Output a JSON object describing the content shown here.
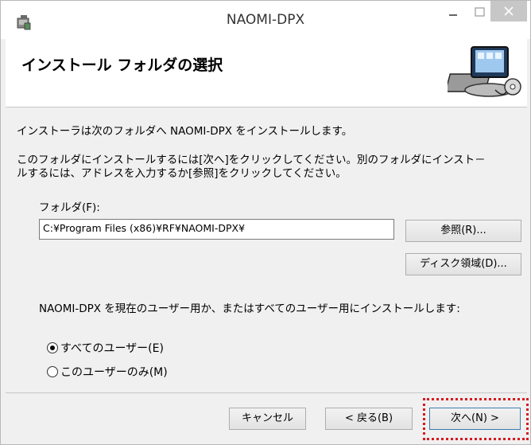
{
  "window": {
    "title": "NAOMI-DPX",
    "minimize_glyph": "–",
    "close_glyph": "✕"
  },
  "header": {
    "title": "インストール フォルダの選択",
    "art_icon": "computer-install-icon"
  },
  "content": {
    "intro": "インストーラは次のフォルダへ NAOMI-DPX をインストールします。",
    "instructions_line1": "このフォルダにインストールするには[次へ]をクリックしてください。別のフォルダにインスト－",
    "instructions_line2": "ルするには、アドレスを入力するか[参照]をクリックしてください。",
    "folder_label": "フォルダ(F):",
    "folder_value": "C:¥Program Files (x86)¥RF¥NAOMI-DPX¥",
    "browse_button": "参照(R)...",
    "disk_button": "ディスク領域(D)...",
    "scope_text": "NAOMI-DPX を現在のユーザー用か、またはすべてのユーザー用にインストールします:",
    "radio_all_users": "すべてのユーザー(E)",
    "radio_this_user": "このユーザーのみ(M)",
    "selected_option": "all_users"
  },
  "footer": {
    "cancel_button": "キャンセル",
    "back_button": "< 戻る(B)",
    "next_button": "次へ(N) >"
  },
  "colors": {
    "highlight": "#d71920",
    "accent": "#3c7fb1"
  }
}
